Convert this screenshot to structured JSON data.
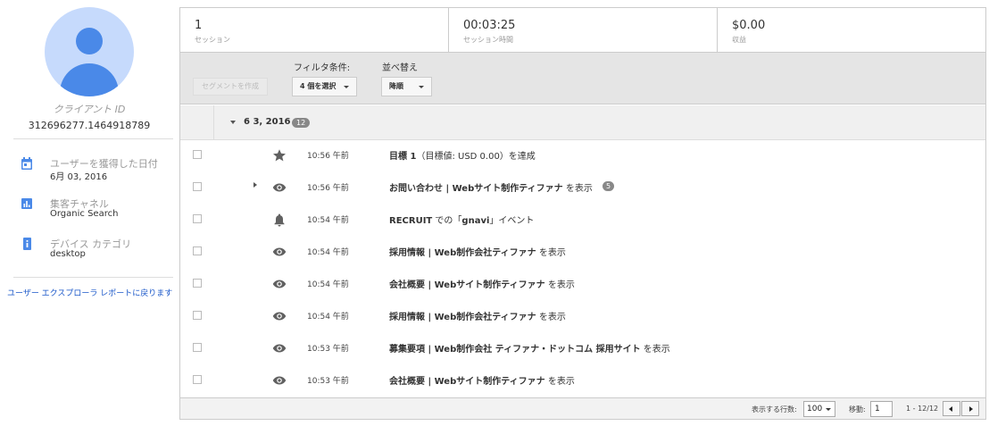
{
  "sidebar": {
    "client_id_label": "クライアント ID",
    "client_id_value": "312696277.1464918789",
    "acquired": {
      "label": "ユーザーを獲得した日付",
      "value": "6月 03, 2016",
      "icon": "calendar-icon"
    },
    "channel": {
      "label": "集客チャネル",
      "value": "Organic Search",
      "icon": "bar-chart-icon"
    },
    "device": {
      "label": "デバイス カテゴリ",
      "value": "desktop",
      "icon": "device-icon"
    },
    "back_link": "ユーザー エクスプローラ レポートに戻ります"
  },
  "stats": [
    {
      "value": "1",
      "label": "セッション"
    },
    {
      "value": "00:03:25",
      "label": "セッション時間"
    },
    {
      "value": "$0.00",
      "label": "収益"
    }
  ],
  "toolbar": {
    "segment_button": "セグメントを作成",
    "filter_label": "フィルタ条件:",
    "filter_value": "4 個を選択",
    "sort_label": "並べ替え",
    "sort_value": "降順"
  },
  "date_group": {
    "date": "6 3, 2016",
    "count": "12"
  },
  "rows": [
    {
      "icon": "star-icon",
      "time": "10:56 午前",
      "bold": "目標 1",
      "rest": "（目標値: USD 0.00）を達成",
      "count": ""
    },
    {
      "icon": "eye-icon",
      "time": "10:56 午前",
      "bold": "お問い合わせ | Webサイト制作ティファナ",
      "rest": " を表示",
      "count": "5"
    },
    {
      "icon": "bell-icon",
      "time": "10:54 午前",
      "bold": "RECRUIT",
      "rest": " での「",
      "bold2": "gnavi",
      "rest2": "」イベント",
      "count": ""
    },
    {
      "icon": "eye-icon",
      "time": "10:54 午前",
      "bold": "採用情報 | Web制作会社ティファナ",
      "rest": " を表示",
      "count": ""
    },
    {
      "icon": "eye-icon",
      "time": "10:54 午前",
      "bold": "会社概要 | Webサイト制作ティファナ",
      "rest": " を表示",
      "count": ""
    },
    {
      "icon": "eye-icon",
      "time": "10:54 午前",
      "bold": "採用情報 | Web制作会社ティファナ",
      "rest": " を表示",
      "count": ""
    },
    {
      "icon": "eye-icon",
      "time": "10:53 午前",
      "bold": "募集要項 | Web制作会社 ティファナ・ドットコム 採用サイト",
      "rest": " を表示",
      "count": ""
    },
    {
      "icon": "eye-icon",
      "time": "10:53 午前",
      "bold": "会社概要 | Webサイト制作ティファナ",
      "rest": " を表示",
      "count": ""
    }
  ],
  "footer": {
    "rows_label": "表示する行数:",
    "rows_value": "100",
    "goto_label": "移動:",
    "goto_value": "1",
    "range": "1 - 12/12"
  },
  "colors": {
    "accent": "#4a89e8",
    "avatar_bg": "#c6dafc",
    "link": "#1a57c9"
  }
}
